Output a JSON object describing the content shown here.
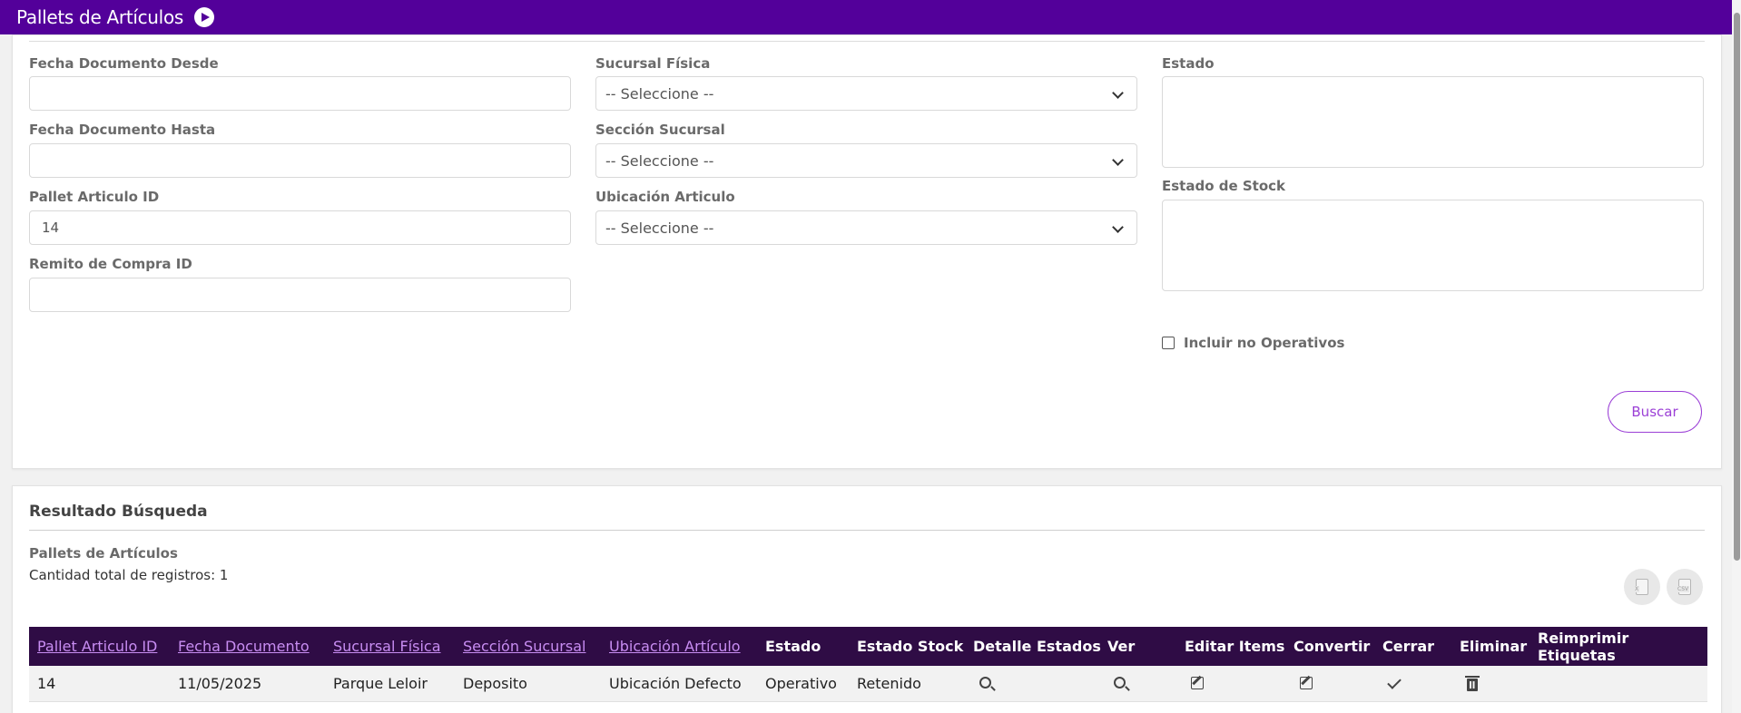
{
  "header": {
    "title": "Pallets de Artículos",
    "icon": "play-circle-icon"
  },
  "filters": {
    "fecha_desde": {
      "label": "Fecha Documento Desde",
      "value": ""
    },
    "fecha_hasta": {
      "label": "Fecha Documento Hasta",
      "value": ""
    },
    "pallet_id": {
      "label": "Pallet Articulo ID",
      "value": "14"
    },
    "remito_id": {
      "label": "Remito de Compra ID",
      "value": ""
    },
    "sucursal_fisica": {
      "label": "Sucursal Física",
      "value": "-- Seleccione --"
    },
    "seccion_sucursal": {
      "label": "Sección Sucursal",
      "value": "-- Seleccione --"
    },
    "ubicacion_articulo": {
      "label": "Ubicación Articulo",
      "value": "-- Seleccione --"
    },
    "estado": {
      "label": "Estado"
    },
    "estado_stock": {
      "label": "Estado de Stock"
    },
    "incluir_no_operativos": {
      "label": "Incluir no Operativos",
      "checked": false
    },
    "buscar_label": "Buscar"
  },
  "results": {
    "title": "Resultado Búsqueda",
    "subtitle": "Pallets de Artículos",
    "count_text": "Cantidad total de registros: 1",
    "export_excel_icon": "xls-file-icon",
    "export_csv_icon": "csv-file-icon",
    "columns": {
      "pallet_id": "Pallet Articulo ID",
      "fecha": "Fecha Documento",
      "sucursal": "Sucursal Física",
      "seccion": "Sección Sucursal",
      "ubicacion": "Ubicación Artículo",
      "estado": "Estado",
      "estado_stock": "Estado Stock",
      "detalle": "Detalle Estados",
      "ver": "Ver",
      "editar": "Editar Items",
      "convertir": "Convertir",
      "cerrar": "Cerrar",
      "eliminar": "Eliminar",
      "reimprimir": "Reimprimir Etiquetas"
    },
    "rows": [
      {
        "pallet_id": "14",
        "fecha": "11/05/2025",
        "sucursal": "Parque Leloir",
        "seccion": "Deposito",
        "ubicacion": "Ubicación Defecto",
        "estado": "Operativo",
        "estado_stock": "Retenido"
      }
    ]
  },
  "colors": {
    "header": "#53009a",
    "table_header": "#2f0c45",
    "accent": "#9b3fd6",
    "sort_link": "#c88df2"
  }
}
